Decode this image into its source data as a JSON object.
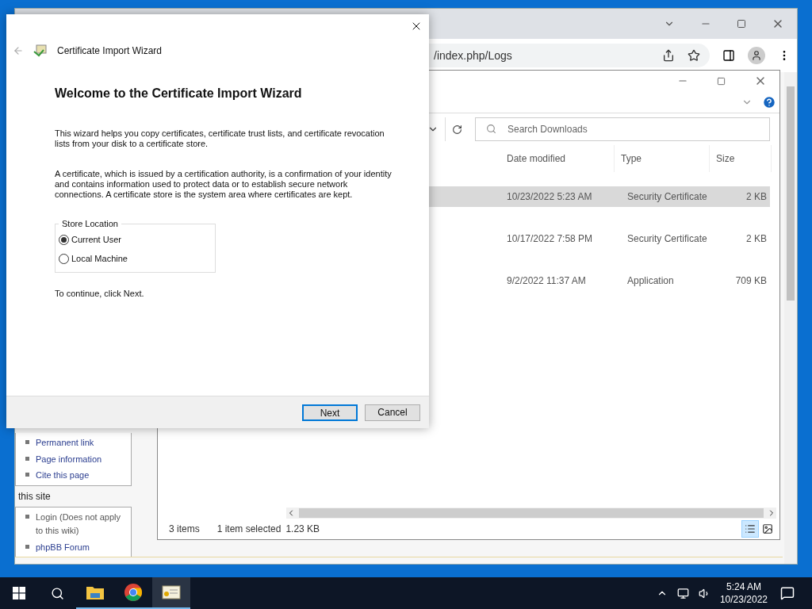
{
  "browser": {
    "address": "/index.php/Logs",
    "sidebar": {
      "links": [
        "Permanent link",
        "Page information",
        "Cite this page"
      ],
      "heading": "this site",
      "site_links": [
        "Login (Does not apply to this wiki)",
        "phpBB Forum"
      ]
    }
  },
  "explorer": {
    "search": {
      "placeholder": "Search Downloads"
    },
    "columns": [
      "Date modified",
      "Type",
      "Size"
    ],
    "rows": [
      {
        "date": "10/23/2022 5:23 AM",
        "type": "Security Certificate",
        "size": "2 KB",
        "selected": true
      },
      {
        "date": "10/17/2022 7:58 PM",
        "type": "Security Certificate",
        "size": "2 KB",
        "selected": false
      },
      {
        "date": "9/2/2022 11:37 AM",
        "type": "Application",
        "size": "709 KB",
        "selected": false
      }
    ],
    "status": {
      "count": "3 items",
      "selection": "1 item selected",
      "size": "1.23 KB"
    },
    "views": [
      {
        "kind": "details",
        "selected": true
      },
      {
        "kind": "preview",
        "selected": false
      }
    ]
  },
  "wizard": {
    "title": "Certificate Import Wizard",
    "heading": "Welcome to the Certificate Import Wizard",
    "paragraphs": [
      "This wizard helps you copy certificates, certificate trust lists, and certificate revocation lists from your disk to a certificate store.",
      "A certificate, which is issued by a certification authority, is a confirmation of your identity and contains information used to protect data or to establish secure network connections. A certificate store is the system area where certificates are kept."
    ],
    "store_location": {
      "legend": "Store Location",
      "options": [
        {
          "label": "Current User",
          "selected": true
        },
        {
          "label": "Local Machine",
          "selected": false
        }
      ]
    },
    "hint": "To continue, click Next.",
    "buttons": [
      {
        "label": "Next",
        "default": true
      },
      {
        "label": "Cancel",
        "default": false
      }
    ]
  },
  "taskbar": {
    "apps": [
      {
        "kind": "explorer",
        "active": false
      },
      {
        "kind": "chrome",
        "active": false
      },
      {
        "kind": "certificate",
        "active": true
      }
    ],
    "time": "5:24 AM",
    "date": "10/23/2022"
  }
}
